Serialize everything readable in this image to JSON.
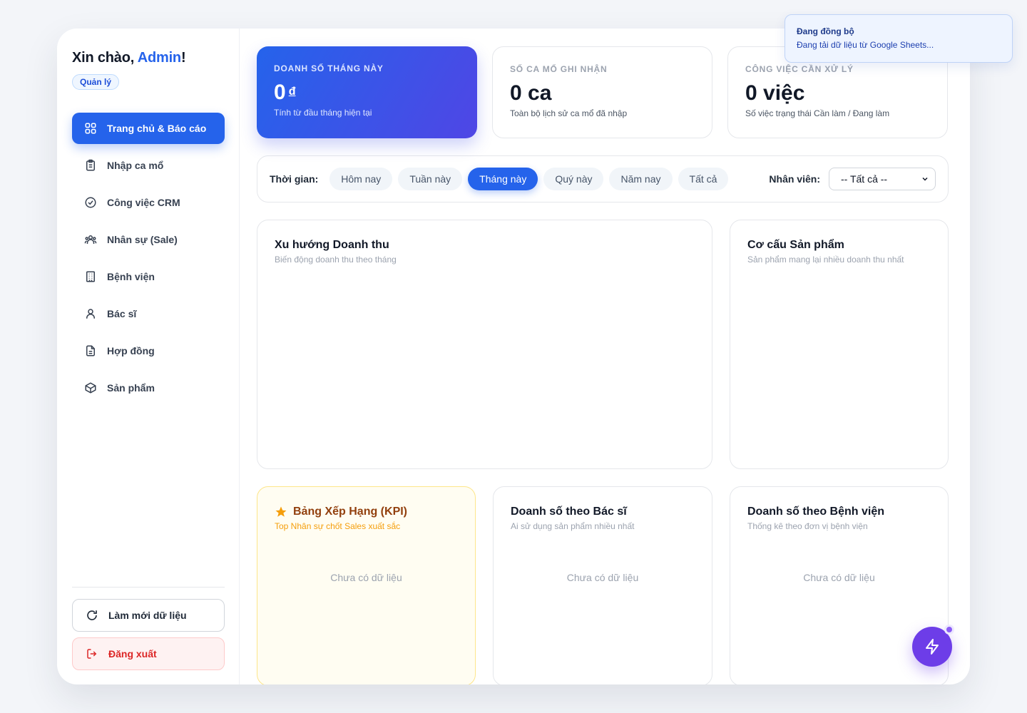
{
  "sidebar": {
    "greeting_prefix": "Xin chào, ",
    "user_name": "Admin",
    "greeting_suffix": "!",
    "role": "Quản lý",
    "items": [
      {
        "label": "Trang chủ & Báo cáo",
        "icon": "grid-icon",
        "active": true
      },
      {
        "label": "Nhập ca mổ",
        "icon": "clipboard-icon"
      },
      {
        "label": "Công việc CRM",
        "icon": "check-circle-icon"
      },
      {
        "label": "Nhân sự (Sale)",
        "icon": "users-icon"
      },
      {
        "label": "Bệnh viện",
        "icon": "building-icon"
      },
      {
        "label": "Bác sĩ",
        "icon": "user-icon"
      },
      {
        "label": "Hợp đồng",
        "icon": "document-icon"
      },
      {
        "label": "Sản phẩm",
        "icon": "box-icon"
      }
    ],
    "refresh_label": "Làm mới dữ liệu",
    "logout_label": "Đăng xuất"
  },
  "stats": [
    {
      "label": "DOANH SỐ THÁNG NÀY",
      "value": "0",
      "unit": "đ",
      "note": "Tính từ đầu tháng hiện tại"
    },
    {
      "label": "SỐ CA MỔ GHI NHẬN",
      "value": "0 ca",
      "note": "Toàn bộ lịch sử ca mổ đã nhập"
    },
    {
      "label": "CÔNG VIỆC CẦN XỬ LÝ",
      "value": "0 việc",
      "note": "Số việc trạng thái Cần làm / Đang làm"
    }
  ],
  "filters": {
    "time_label": "Thời gian:",
    "periods": [
      "Hôm nay",
      "Tuần này",
      "Tháng này",
      "Quý này",
      "Năm nay",
      "Tất cả"
    ],
    "active_period": "Tháng này",
    "staff_label": "Nhân viên:",
    "staff_selected": "-- Tất cả --"
  },
  "charts": {
    "revenue_trend": {
      "title": "Xu hướng Doanh thu",
      "subtitle": "Biến động doanh thu theo tháng"
    },
    "product_mix": {
      "title": "Cơ cấu Sản phẩm",
      "subtitle": "Sản phẩm mang lại nhiều doanh thu nhất"
    }
  },
  "panels": {
    "kpi": {
      "title": "Bảng Xếp Hạng (KPI)",
      "subtitle": "Top Nhân sự chốt Sales xuất sắc",
      "empty": "Chưa có dữ liệu"
    },
    "by_doctor": {
      "title": "Doanh số theo Bác sĩ",
      "subtitle": "Ai sử dụng sản phẩm nhiều nhất",
      "empty": "Chưa có dữ liệu"
    },
    "by_hospital": {
      "title": "Doanh số theo Bệnh viện",
      "subtitle": "Thống kê theo đơn vị bệnh viện",
      "empty": "Chưa có dữ liệu"
    }
  },
  "toast": {
    "title": "Đang đồng bộ",
    "message": "Đang tải dữ liệu từ Google Sheets..."
  },
  "colors": {
    "primary": "#2563eb",
    "accent": "#4f46e5",
    "fab": "#6d3de8",
    "danger": "#dc2626",
    "kpi_title": "#92400e"
  }
}
